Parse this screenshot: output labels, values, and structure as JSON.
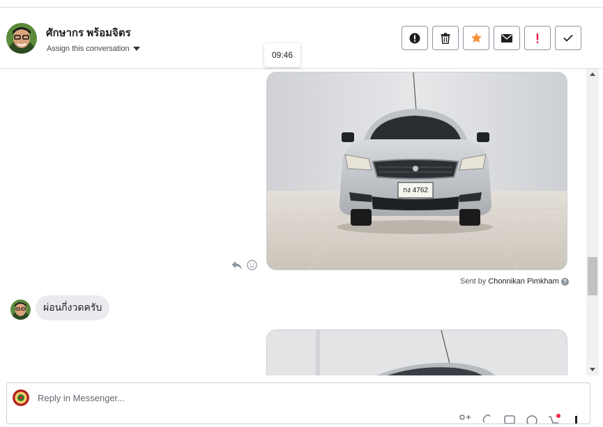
{
  "header": {
    "contact_name": "ศักษากร พร้อมจิตร",
    "assign_label": "Assign this conversation",
    "actions": [
      {
        "name": "spam",
        "icon": "alert-circle-icon"
      },
      {
        "name": "delete",
        "icon": "trash-icon"
      },
      {
        "name": "star",
        "icon": "star-icon",
        "color": "#f7923b"
      },
      {
        "name": "mark-unread",
        "icon": "envelope-icon"
      },
      {
        "name": "follow-up",
        "icon": "exclamation-icon",
        "color": "#e41e3f"
      },
      {
        "name": "mark-done",
        "icon": "check-icon"
      }
    ]
  },
  "tooltip": {
    "time": "09:46"
  },
  "thread": {
    "sent_by_prefix": "Sent by",
    "sent_by_name": "Chonnikan Pimkham",
    "incoming_message": "ผ่อนกี่งวดครับ",
    "plate_text": "กง 4762"
  },
  "composer": {
    "placeholder": "Reply in Messenger..."
  },
  "colors": {
    "accent_star": "#f7923b",
    "flag_red": "#e41e3f",
    "notification_dot": "#f02849",
    "bubble_bg": "#e9ebee",
    "border": "#dadde1"
  }
}
